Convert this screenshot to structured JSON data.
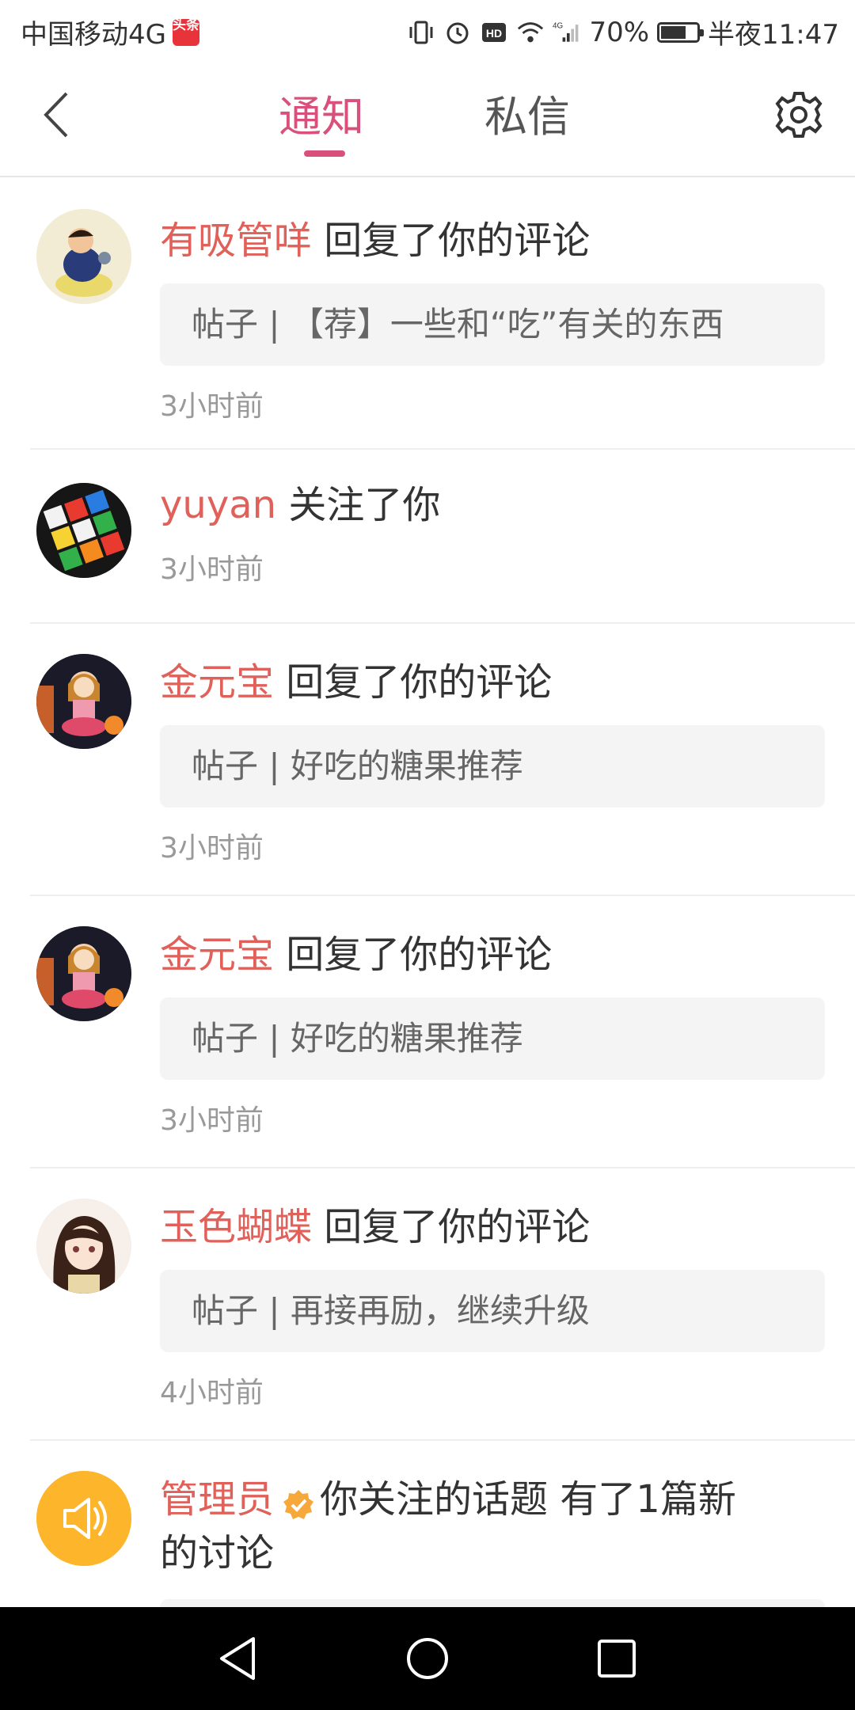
{
  "status_bar": {
    "carrier": "中国移动4G",
    "badge": "头条",
    "battery": "70%",
    "battery_level": 0.7,
    "time": "半夜11:47"
  },
  "header": {
    "tab_notify": "通知",
    "tab_messages": "私信"
  },
  "notifications": [
    {
      "user": "有吸管咩",
      "action": " 回复了你的评论",
      "snippet": "帖子 | 【荐】一些和“吃”有关的东西",
      "time": "3小时前"
    },
    {
      "user": "yuyan",
      "action": " 关注了你",
      "time": "3小时前"
    },
    {
      "user": "金元宝",
      "action": " 回复了你的评论",
      "snippet": "帖子 | 好吃的糖果推荐",
      "time": "3小时前"
    },
    {
      "user": "金元宝",
      "action": " 回复了你的评论",
      "snippet": "帖子 | 好吃的糖果推荐",
      "time": "3小时前"
    },
    {
      "user": "玉色蝴蝶",
      "action": " 回复了你的评论",
      "snippet": "帖子 | 再接再励，继续升级",
      "time": "4小时前"
    },
    {
      "user": "管理员",
      "action": "你关注的话题 有了1篇新",
      "action_line2": "的讨论"
    }
  ],
  "colors": {
    "accent": "#d9507a",
    "username": "#e0605a",
    "admin_avatar": "#fdb62b",
    "verified_badge": "#f6a83a"
  }
}
